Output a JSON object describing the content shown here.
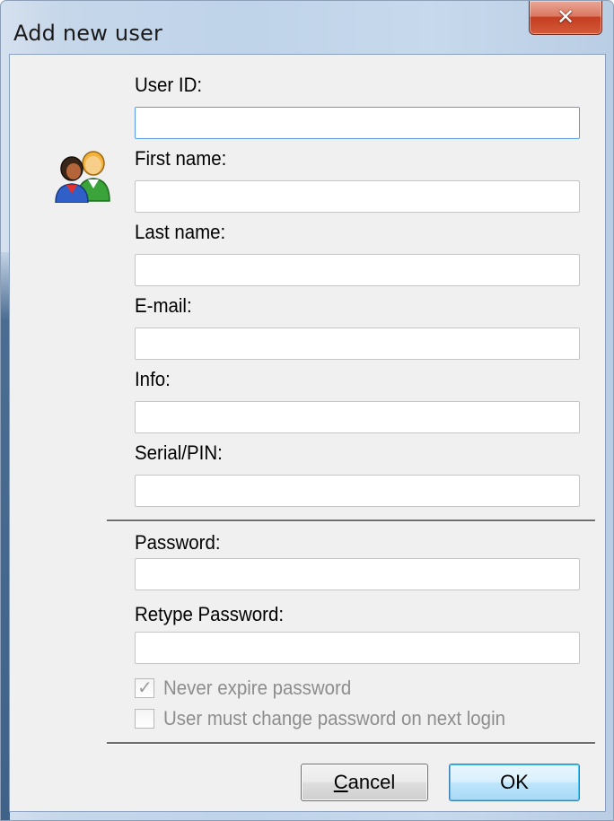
{
  "window": {
    "title": "Add new user",
    "close_icon": "close-icon"
  },
  "icons": {
    "users": "users-icon"
  },
  "fields": {
    "user_id": {
      "label": "User ID:",
      "value": ""
    },
    "first_name": {
      "label": "First name:",
      "value": ""
    },
    "last_name": {
      "label": "Last name:",
      "value": ""
    },
    "email": {
      "label": "E-mail:",
      "value": ""
    },
    "info": {
      "label": "Info:",
      "value": ""
    },
    "serial_pin": {
      "label": "Serial/PIN:",
      "value": ""
    },
    "password": {
      "label": "Password:",
      "value": ""
    },
    "retype_password": {
      "label": "Retype Password:",
      "value": ""
    }
  },
  "checkboxes": {
    "never_expire": {
      "label": "Never expire password",
      "checked": true,
      "enabled": false
    },
    "must_change": {
      "label": "User must change password on next login",
      "checked": false,
      "enabled": false
    }
  },
  "buttons": {
    "cancel_mnemonic": "C",
    "cancel_rest": "ancel",
    "ok": "OK"
  },
  "colors": {
    "client_bg": "#f0f0f0",
    "focus_border": "#569de5",
    "close_red": "#c53e22",
    "ok_blue": "#bee6fd"
  }
}
